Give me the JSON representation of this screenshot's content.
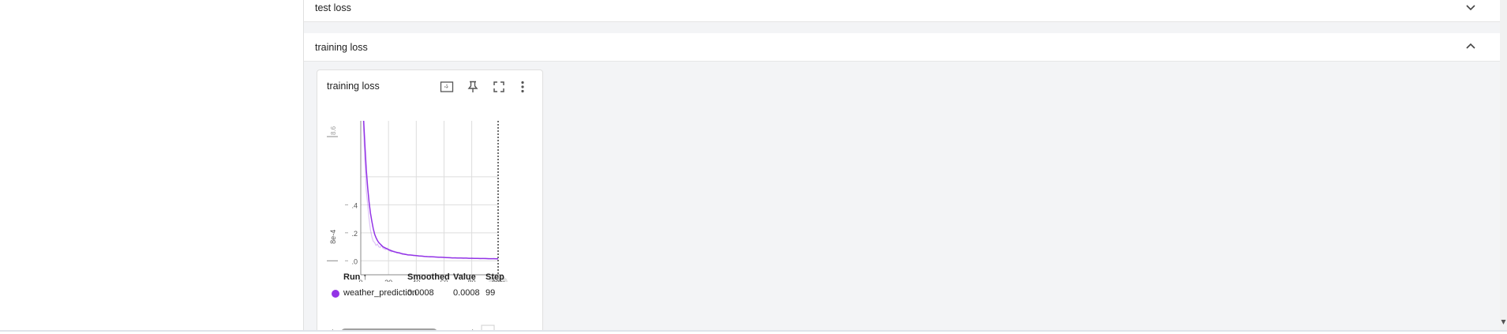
{
  "sections": [
    {
      "title": "test loss",
      "expanded": false,
      "toggle_icon": "chevron-down-icon"
    },
    {
      "title": "training loss",
      "expanded": true,
      "toggle_icon": "chevron-up-icon"
    }
  ],
  "card": {
    "title": "training loss",
    "tools": [
      "fit-domain-icon",
      "pin-icon",
      "fullscreen-icon",
      "more-vert-icon"
    ]
  },
  "chart_data": {
    "type": "line",
    "title": "training loss",
    "xlabel": "",
    "ylabel": "",
    "y_tick_labels": [
      ".4",
      ".2",
      ".0"
    ],
    "y_exponent_label": "8e-4",
    "y_clipped_label": "8.6",
    "x_ticks": [
      0,
      20,
      40,
      60,
      80
    ],
    "x_tick_labels": [
      "0",
      "20",
      "40",
      "60",
      "80"
    ],
    "xlim": [
      0,
      99
    ],
    "ylim": [
      -0.1,
      1.0
    ],
    "cursor_step": 99,
    "cursor_label": "99",
    "grid": true,
    "series": [
      {
        "name": "weather_prediction",
        "color": "#9334e6",
        "x": [
          0,
          1,
          2,
          3,
          4,
          5,
          6,
          7,
          8,
          9,
          10,
          11,
          12,
          13,
          14,
          15,
          16,
          17,
          18,
          19,
          20,
          22,
          24,
          26,
          28,
          30,
          32,
          34,
          36,
          38,
          40,
          42,
          44,
          46,
          48,
          50,
          52,
          54,
          56,
          58,
          60,
          62,
          64,
          66,
          68,
          70,
          72,
          74,
          76,
          78,
          80,
          82,
          84,
          86,
          88,
          90,
          92,
          94,
          96,
          98,
          99
        ],
        "smoothed": [
          1.6,
          1.3,
          1.02,
          0.82,
          0.65,
          0.52,
          0.42,
          0.34,
          0.28,
          0.23,
          0.19,
          0.165,
          0.145,
          0.13,
          0.12,
          0.11,
          0.1,
          0.095,
          0.09,
          0.085,
          0.08,
          0.072,
          0.065,
          0.06,
          0.055,
          0.05,
          0.046,
          0.043,
          0.041,
          0.039,
          0.037,
          0.035,
          0.033,
          0.031,
          0.03,
          0.029,
          0.028,
          0.027,
          0.026,
          0.025,
          0.024,
          0.023,
          0.022,
          0.021,
          0.021,
          0.02,
          0.02,
          0.019,
          0.019,
          0.018,
          0.018,
          0.017,
          0.017,
          0.016,
          0.016,
          0.016,
          0.015,
          0.015,
          0.015,
          0.014,
          0.014
        ],
        "raw": [
          1.7,
          1.25,
          0.95,
          0.7,
          0.5,
          0.4,
          0.3,
          0.22,
          0.17,
          0.14,
          0.13,
          0.11,
          0.12,
          0.1,
          0.095,
          0.11,
          0.09,
          0.085,
          0.08,
          0.09,
          0.075,
          0.065,
          0.07,
          0.055,
          0.06,
          0.045,
          0.05,
          0.04,
          0.042,
          0.036,
          0.038,
          0.033,
          0.035,
          0.03,
          0.031,
          0.027,
          0.029,
          0.026,
          0.027,
          0.024,
          0.025,
          0.022,
          0.023,
          0.02,
          0.022,
          0.019,
          0.021,
          0.018,
          0.02,
          0.017,
          0.019,
          0.016,
          0.018,
          0.015,
          0.017,
          0.015,
          0.016,
          0.014,
          0.016,
          0.013,
          0.014
        ]
      }
    ]
  },
  "table": {
    "headers": {
      "run": "Run ↑",
      "smoothed": "Smoothed",
      "value": "Value",
      "step": "Step"
    },
    "rows": [
      {
        "run": "weather_prediction",
        "smoothed": "0.0008",
        "value": "0.0008",
        "step": "99",
        "color": "#9334e6"
      }
    ]
  }
}
